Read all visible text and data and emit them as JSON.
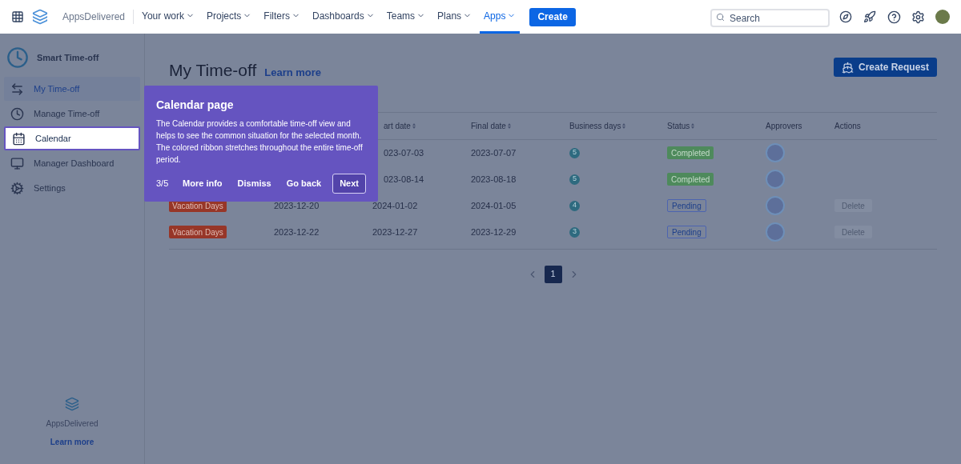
{
  "topnav": {
    "brand": "AppsDelivered",
    "menus": [
      {
        "label": "Your work",
        "selected": false
      },
      {
        "label": "Projects",
        "selected": false
      },
      {
        "label": "Filters",
        "selected": false
      },
      {
        "label": "Dashboards",
        "selected": false
      },
      {
        "label": "Teams",
        "selected": false
      },
      {
        "label": "Plans",
        "selected": false
      },
      {
        "label": "Apps",
        "selected": true
      }
    ],
    "create": "Create",
    "search": {
      "placeholder": "Search"
    }
  },
  "sidebar": {
    "app_title": "Smart Time-off",
    "items": [
      {
        "label": "My Time-off",
        "selected": true,
        "highlighted": false
      },
      {
        "label": "Manage Time-off",
        "selected": false,
        "highlighted": false
      },
      {
        "label": "Calendar",
        "selected": false,
        "highlighted": true
      },
      {
        "label": "Manager Dashboard",
        "selected": false,
        "highlighted": false
      },
      {
        "label": "Settings",
        "selected": false,
        "highlighted": false
      }
    ],
    "footer_brand": "AppsDelivered",
    "footer_link": "Learn more"
  },
  "page": {
    "title": "My Time-off",
    "learn_more": "Learn more",
    "create_request": "Create Request"
  },
  "table": {
    "columns": [
      {
        "label": "art date",
        "sortable": true
      },
      {
        "label": "Final date",
        "sortable": true
      },
      {
        "label": "Business days",
        "sortable": true
      },
      {
        "label": "Status",
        "sortable": true
      },
      {
        "label": "Approvers",
        "sortable": false
      },
      {
        "label": "Actions",
        "sortable": false
      }
    ],
    "rows": [
      {
        "start": "023-07-03",
        "final": "2023-07-07",
        "days": "5",
        "status": "Completed",
        "kind": "completed"
      },
      {
        "start": "023-08-14",
        "final": "2023-08-18",
        "days": "5",
        "status": "Completed",
        "kind": "completed"
      },
      {
        "type": "Vacation Days",
        "column_2": "2023-12-20",
        "start": "2024-01-02",
        "final": "2024-01-05",
        "days": "4",
        "status": "Pending",
        "kind": "pending",
        "action": "Delete"
      },
      {
        "type": "Vacation Days",
        "column_2": "2023-12-22",
        "start": "2023-12-27",
        "final": "2023-12-29",
        "days": "3",
        "status": "Pending",
        "kind": "pending",
        "action": "Delete"
      }
    ]
  },
  "pagination": {
    "pages": [
      {
        "label": "1",
        "selected": true
      }
    ]
  },
  "tour": {
    "title": "Calendar page",
    "body": "The Calendar provides a comfortable time-off view and helps to see the common situation for the selected month. The colored ribbon stretches throughout the entire time-off period.",
    "step": "3/5",
    "buttons": [
      "More info",
      "Dismiss",
      "Go back"
    ],
    "next": "Next"
  }
}
